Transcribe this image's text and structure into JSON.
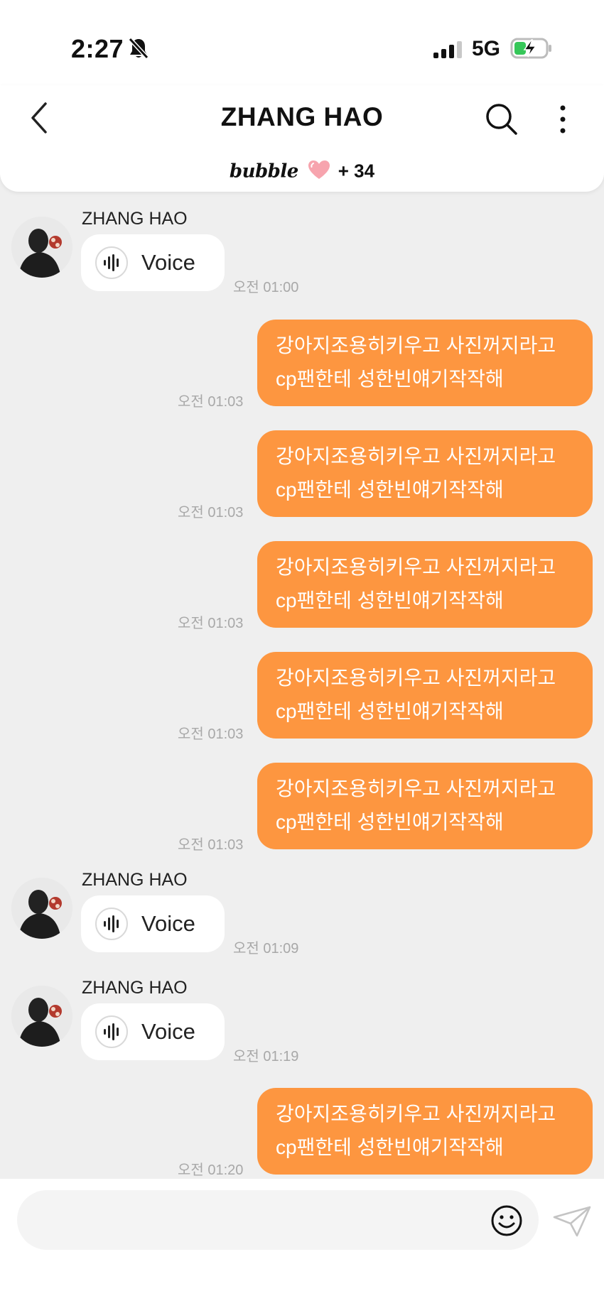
{
  "status_bar": {
    "time": "2:27",
    "network": "5G",
    "icons": [
      "bell-slash-icon",
      "signal-bars-icon",
      "battery-charging-icon"
    ]
  },
  "header": {
    "title": "ZHANG HAO",
    "bubble_brand": "bubble",
    "bubble_count": "+ 34",
    "icons": [
      "back-chevron-icon",
      "search-icon",
      "more-vertical-icon",
      "heart-icon"
    ]
  },
  "colors": {
    "outgoing_bubble": "#fd9640",
    "chat_background": "#efefef",
    "timestamp": "#a8a8a8"
  },
  "messages": [
    {
      "direction": "in",
      "sender": "ZHANG HAO",
      "type": "voice",
      "label": "Voice",
      "time": "오전 01:00"
    },
    {
      "direction": "out",
      "line1": "강아지조용히키우고 사진꺼지라고",
      "line2": "cp팬한테 성한빈얘기작작해",
      "time": "오전 01:03"
    },
    {
      "direction": "out",
      "line1": "강아지조용히키우고 사진꺼지라고",
      "line2": "cp팬한테 성한빈얘기작작해",
      "time": "오전 01:03"
    },
    {
      "direction": "out",
      "line1": "강아지조용히키우고 사진꺼지라고",
      "line2": "cp팬한테 성한빈얘기작작해",
      "time": "오전 01:03"
    },
    {
      "direction": "out",
      "line1": "강아지조용히키우고 사진꺼지라고",
      "line2": "cp팬한테 성한빈얘기작작해",
      "time": "오전 01:03"
    },
    {
      "direction": "out",
      "line1": "강아지조용히키우고 사진꺼지라고",
      "line2": "cp팬한테 성한빈얘기작작해",
      "time": "오전 01:03"
    },
    {
      "direction": "in",
      "sender": "ZHANG HAO",
      "type": "voice",
      "label": "Voice",
      "time": "오전 01:09"
    },
    {
      "direction": "in",
      "sender": "ZHANG HAO",
      "type": "voice",
      "label": "Voice",
      "time": "오전 01:19"
    },
    {
      "direction": "out",
      "line1": "강아지조용히키우고 사진꺼지라고",
      "line2": "cp팬한테 성한빈얘기작작해",
      "time": "오전 01:20"
    }
  ],
  "composer": {
    "value": "",
    "placeholder": "",
    "icons": [
      "emoji-smile-icon",
      "send-paper-plane-icon"
    ]
  }
}
